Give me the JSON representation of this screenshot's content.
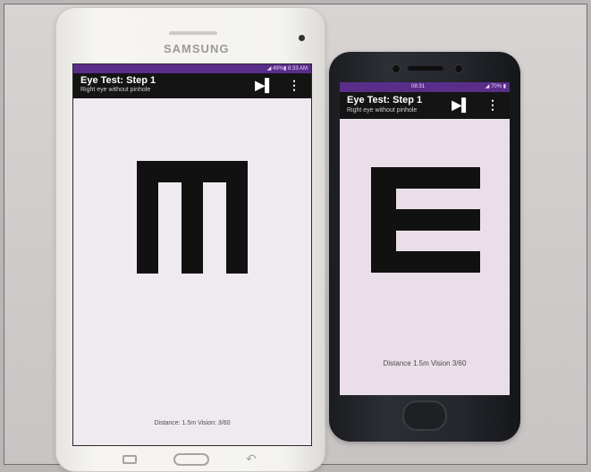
{
  "tablet": {
    "brand": "SAMSUNG",
    "status_right": "◢ 49%▮ 8:33 AM",
    "app_title": "Eye Test: Step 1",
    "app_subtitle": "Right eye without pinhole",
    "skip_icon": "▶▌",
    "menu_icon": "⋮",
    "optotype": {
      "letter": "E",
      "orientation": "down"
    },
    "distance_text": "Distance: 1.5m   Vision: 3/60"
  },
  "phone": {
    "status_center": "08:31",
    "status_right": "◢ 70% ▮",
    "app_title": "Eye Test: Step 1",
    "app_subtitle": "Right eye without pinhole",
    "skip_icon": "▶▌",
    "menu_icon": "⋮",
    "optotype": {
      "letter": "E",
      "orientation": "right"
    },
    "distance_text": "Distance 1.5m  Vision 3/60"
  },
  "colors": {
    "status_bar": "#5a2d8a",
    "app_bar": "#141414",
    "screen_bg": "#efe9f0",
    "optotype": "#111111"
  }
}
